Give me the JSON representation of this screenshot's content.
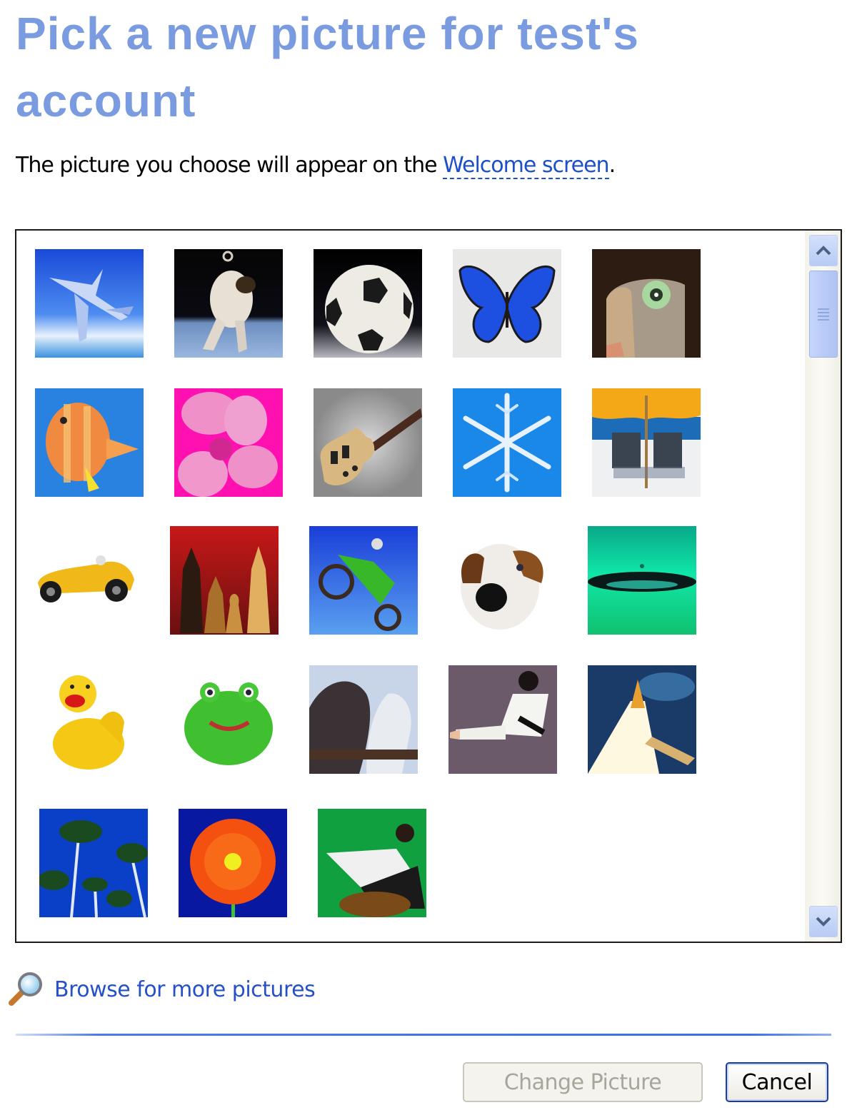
{
  "header": {
    "title": "Pick a new picture for test's account",
    "subtitle_prefix": "The picture you choose will appear on the ",
    "subtitle_link": "Welcome screen",
    "subtitle_suffix": "."
  },
  "picture_list": {
    "pictures": [
      {
        "name": "Airplane",
        "icon": "airplane"
      },
      {
        "name": "Astronaut",
        "icon": "astronaut"
      },
      {
        "name": "Soccer ball",
        "icon": "soccer-ball"
      },
      {
        "name": "Butterfly",
        "icon": "butterfly"
      },
      {
        "name": "Cat",
        "icon": "cat"
      },
      {
        "name": "Fish",
        "icon": "fish"
      },
      {
        "name": "Flower",
        "icon": "pink-flower"
      },
      {
        "name": "Guitar",
        "icon": "guitar"
      },
      {
        "name": "Snowflake",
        "icon": "snowflake"
      },
      {
        "name": "Beach chairs",
        "icon": "beach-chairs"
      },
      {
        "name": "Car",
        "icon": "race-car"
      },
      {
        "name": "Chess",
        "icon": "chess"
      },
      {
        "name": "Dirt bike",
        "icon": "dirt-bike"
      },
      {
        "name": "Dog",
        "icon": "dog"
      },
      {
        "name": "Water drop",
        "icon": "water-drop"
      },
      {
        "name": "Rubber duck",
        "icon": "rubber-duck"
      },
      {
        "name": "Frog",
        "icon": "frog"
      },
      {
        "name": "Horses",
        "icon": "horses"
      },
      {
        "name": "Karate",
        "icon": "karate"
      },
      {
        "name": "Space shuttle",
        "icon": "space-shuttle"
      },
      {
        "name": "Palm trees",
        "icon": "palm-trees"
      },
      {
        "name": "Orange flower",
        "icon": "orange-flower"
      },
      {
        "name": "Skateboarder",
        "icon": "skateboarder"
      }
    ],
    "scroll_position": 0
  },
  "browse_link": {
    "label": "Browse for more pictures",
    "icon": "magnifier"
  },
  "buttons": {
    "change_picture": {
      "label": "Change Picture",
      "enabled": false
    },
    "cancel": {
      "label": "Cancel",
      "enabled": true
    }
  },
  "colors": {
    "title": "#7a9be0",
    "link": "#1c4fc8",
    "divider": "#3b6fe0",
    "scrollbar": "#b9cbf7"
  }
}
